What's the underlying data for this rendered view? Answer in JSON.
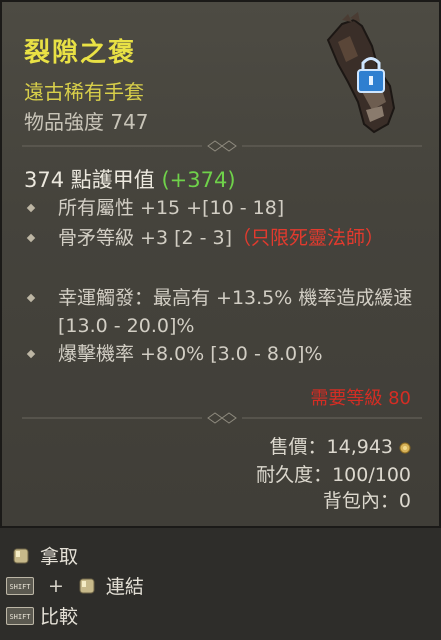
{
  "item": {
    "name": "裂隙之褒",
    "type": "遠古稀有手套",
    "power": "物品強度 747"
  },
  "stats": {
    "armor_value": "374 點護甲值",
    "armor_bonus": "(+374)",
    "affixes": [
      {
        "text": "所有屬性 +15 +[10 - 18]"
      },
      {
        "text": "骨矛等級 +3 [2 - 3]",
        "red": "（只限死靈法師）"
      },
      {
        "text": "幸運觸發：最高有 +13.5% 機率造成緩速 [13.0 - 20.0]%"
      },
      {
        "text": "爆擊機率 +8.0% [3.0 - 8.0]%"
      }
    ],
    "requirement": "需要等級 80"
  },
  "footer_info": {
    "price": "售價：14,943",
    "durability": "耐久度：100/100",
    "bag": "背包內：0"
  },
  "controls": {
    "pickup": "拿取",
    "shift_key": "SHIFT",
    "plus": "+",
    "link": "連結",
    "compare": "比較"
  },
  "colors": {
    "item_name": "#e9e145",
    "bonus_green": "#6fd24a",
    "warning_red": "#d42d24"
  },
  "icons": [
    "gauntlet-icon",
    "lock-icon",
    "coin-icon",
    "mouse-icon",
    "shift-key-icon"
  ]
}
